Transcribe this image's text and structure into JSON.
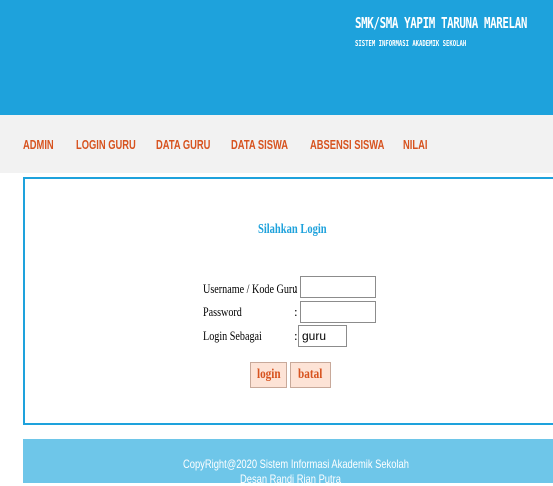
{
  "header": {
    "title": "SMK/SMA YAPIM TARUNA MARELAN",
    "subtitle": "SISTEM INFORMASI AKADEMIK SEKOLAH"
  },
  "nav": {
    "items": [
      {
        "label": "ADMIN"
      },
      {
        "label": "LOGIN GURU"
      },
      {
        "label": "DATA GURU"
      },
      {
        "label": "DATA SISWA"
      },
      {
        "label": "ABSENSI SISWA"
      },
      {
        "label": "NILAI"
      }
    ]
  },
  "login": {
    "title": "Silahkan Login",
    "username_label": "Username / Kode Guru",
    "password_label": "Password",
    "role_label": "Login Sebagai",
    "colon": ":",
    "username_value": "",
    "password_value": "",
    "role_value": "guru",
    "login_button": "login",
    "cancel_button": "batal"
  },
  "footer": {
    "copyright": "CopyRight@2020 Sistem Informasi Akademik Sekolah",
    "credit": "Desan Randi Rian Putra"
  },
  "colors": {
    "header_bg": "#1ea2dc",
    "nav_text": "#d7531f",
    "footer_bg": "#6ec6e9"
  }
}
